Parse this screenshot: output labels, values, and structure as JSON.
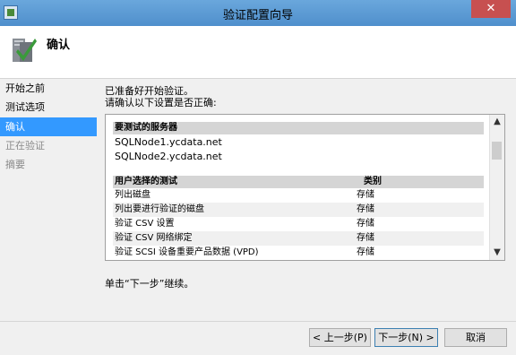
{
  "window": {
    "title": "验证配置向导",
    "close_label": "✕"
  },
  "header": {
    "title": "确认",
    "icon": "cluster-validate-icon"
  },
  "sidebar": {
    "items": [
      {
        "label": "开始之前",
        "state": "normal"
      },
      {
        "label": "测试选项",
        "state": "normal"
      },
      {
        "label": "确认",
        "state": "active"
      },
      {
        "label": "正在验证",
        "state": "disabled"
      },
      {
        "label": "摘要",
        "state": "disabled"
      }
    ]
  },
  "main": {
    "intro_line1": "已准备好开始验证。",
    "intro_line2": "请确认以下设置是否正确:",
    "servers_header": "要测试的服务器",
    "servers": [
      "SQLNode1.ycdata.net",
      "SQLNode2.ycdata.net"
    ],
    "tests_header": "用户选择的测试",
    "category_header": "类别",
    "tests": [
      {
        "name": "列出磁盘",
        "category": "存储"
      },
      {
        "name": "列出要进行验证的磁盘",
        "category": "存储"
      },
      {
        "name": "验证 CSV 设置",
        "category": "存储"
      },
      {
        "name": "验证 CSV 网络绑定",
        "category": "存储"
      },
      {
        "name": "验证 SCSI 设备重要产品数据 (VPD)",
        "category": "存储"
      }
    ],
    "footer_text": "单击“下一步”继续。"
  },
  "buttons": {
    "back": "< 上一步(P)",
    "next": "下一步(N) >",
    "cancel": "取消"
  },
  "colors": {
    "titlebar": "#5b9bd5",
    "active_item": "#3399ff",
    "close": "#c75050"
  }
}
